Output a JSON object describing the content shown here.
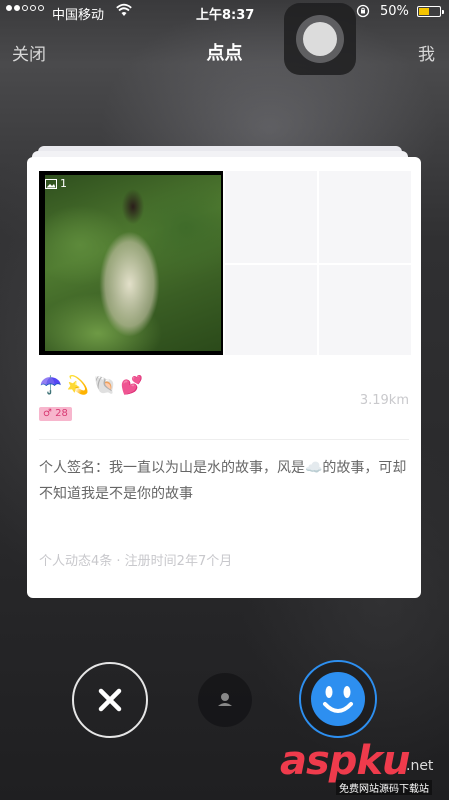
{
  "status_bar": {
    "carrier": "中国移动",
    "time": "上午8:37",
    "battery": "50%",
    "battery_level": 0.5,
    "icons": [
      "signal-dots",
      "wifi-icon",
      "rotation-lock-icon",
      "battery-icon"
    ]
  },
  "nav": {
    "close_label": "关闭",
    "title": "点点",
    "me_label": "我"
  },
  "profile": {
    "photo_count": "1",
    "tags": [
      "☂️",
      "💫",
      "🐚",
      "💕"
    ],
    "age_badge": "♂ 28",
    "distance": "3.19km",
    "signature": "个人签名：我一直以为山是水的故事，风是☁️的故事，可却不知道我是不是你的故事",
    "meta": "个人动态4条 · 注册时间2年7个月"
  },
  "actions": {
    "dislike_icon": "close-icon",
    "profile_icon": "person-icon",
    "like_icon": "smile-icon",
    "like_color": "#2d8ff0"
  },
  "watermark": {
    "brand": "aspku",
    "suffix": ".net",
    "sub": "免费网站源码下载站"
  }
}
